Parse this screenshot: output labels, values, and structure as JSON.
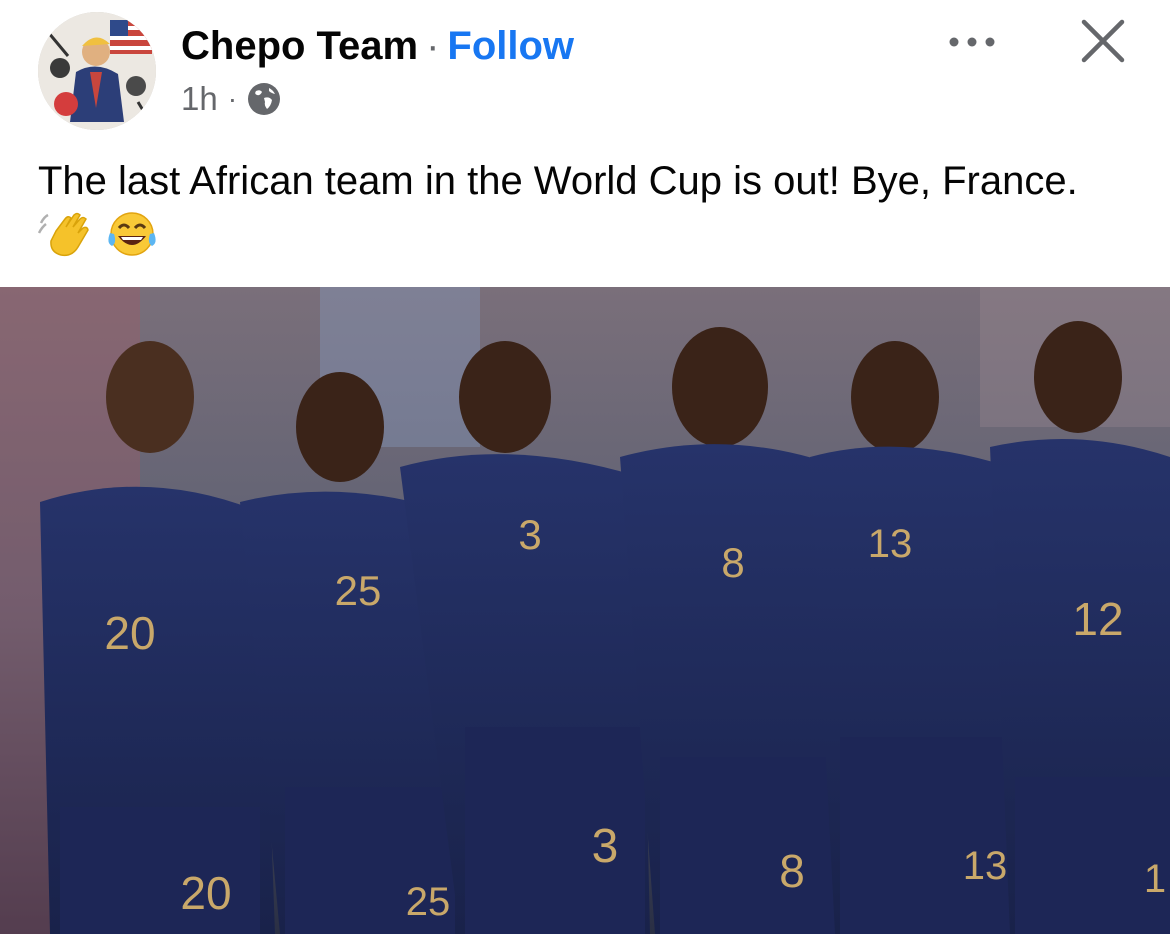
{
  "post": {
    "author": "Chepo Team",
    "separator": "·",
    "follow_label": "Follow",
    "time": "1h",
    "meta_separator": "·",
    "privacy_icon": "globe-icon",
    "text": "The last African team in the World Cup is out! Bye, France.",
    "emojis": [
      "waving-hand-icon",
      "tears-of-joy-icon"
    ]
  },
  "header_actions": {
    "more_icon": "more-horizontal-icon",
    "close_icon": "close-icon"
  },
  "photo": {
    "jersey_numbers": [
      "20",
      "25",
      "3",
      "8",
      "13",
      "12"
    ],
    "short_numbers": [
      "20",
      "25",
      "3",
      "8",
      "13",
      "1"
    ]
  },
  "colors": {
    "follow": "#1877f2",
    "secondary_text": "#65676b",
    "jersey": "#1e2b5a",
    "gold": "#c9a86a"
  }
}
